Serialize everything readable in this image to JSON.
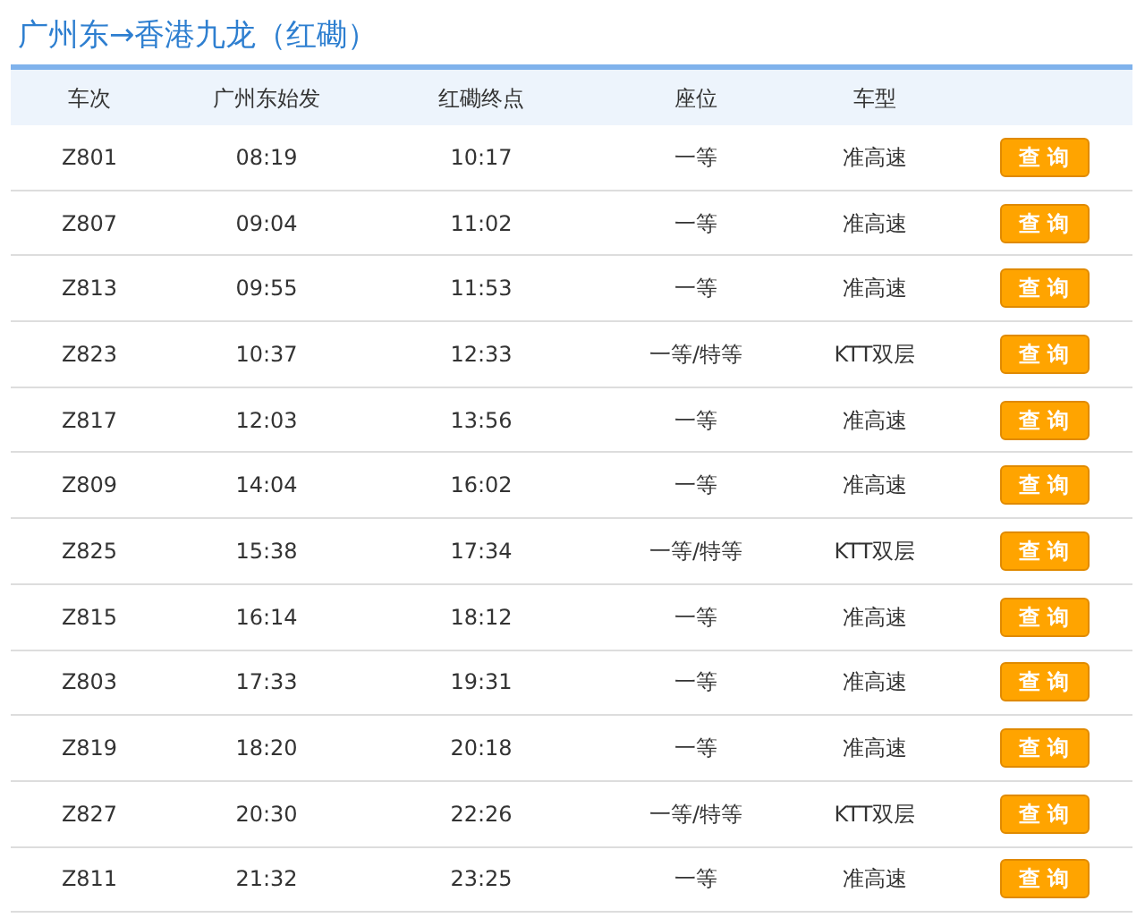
{
  "title": "广州东→香港九龙（红磡）",
  "table": {
    "columns": [
      "车次",
      "广州东始发",
      "红磡终点",
      "座位",
      "车型",
      ""
    ],
    "rows": [
      {
        "train": "Z801",
        "depart": "08:19",
        "arrive": "10:17",
        "seat": "一等",
        "type": "准高速",
        "button": "查 询"
      },
      {
        "train": "Z807",
        "depart": "09:04",
        "arrive": "11:02",
        "seat": "一等",
        "type": "准高速",
        "button": "查 询"
      },
      {
        "train": "Z813",
        "depart": "09:55",
        "arrive": "11:53",
        "seat": "一等",
        "type": "准高速",
        "button": "查 询"
      },
      {
        "train": "Z823",
        "depart": "10:37",
        "arrive": "12:33",
        "seat": "一等/特等",
        "type": "KTT双层",
        "button": "查 询"
      },
      {
        "train": "Z817",
        "depart": "12:03",
        "arrive": "13:56",
        "seat": "一等",
        "type": "准高速",
        "button": "查 询"
      },
      {
        "train": "Z809",
        "depart": "14:04",
        "arrive": "16:02",
        "seat": "一等",
        "type": "准高速",
        "button": "查 询"
      },
      {
        "train": "Z825",
        "depart": "15:38",
        "arrive": "17:34",
        "seat": "一等/特等",
        "type": "KTT双层",
        "button": "查 询"
      },
      {
        "train": "Z815",
        "depart": "16:14",
        "arrive": "18:12",
        "seat": "一等",
        "type": "准高速",
        "button": "查 询"
      },
      {
        "train": "Z803",
        "depart": "17:33",
        "arrive": "19:31",
        "seat": "一等",
        "type": "准高速",
        "button": "查 询"
      },
      {
        "train": "Z819",
        "depart": "18:20",
        "arrive": "20:18",
        "seat": "一等",
        "type": "准高速",
        "button": "查 询"
      },
      {
        "train": "Z827",
        "depart": "20:30",
        "arrive": "22:26",
        "seat": "一等/特等",
        "type": "KTT双层",
        "button": "查 询"
      },
      {
        "train": "Z811",
        "depart": "21:32",
        "arrive": "23:25",
        "seat": "一等",
        "type": "准高速",
        "button": "查 询"
      }
    ]
  }
}
